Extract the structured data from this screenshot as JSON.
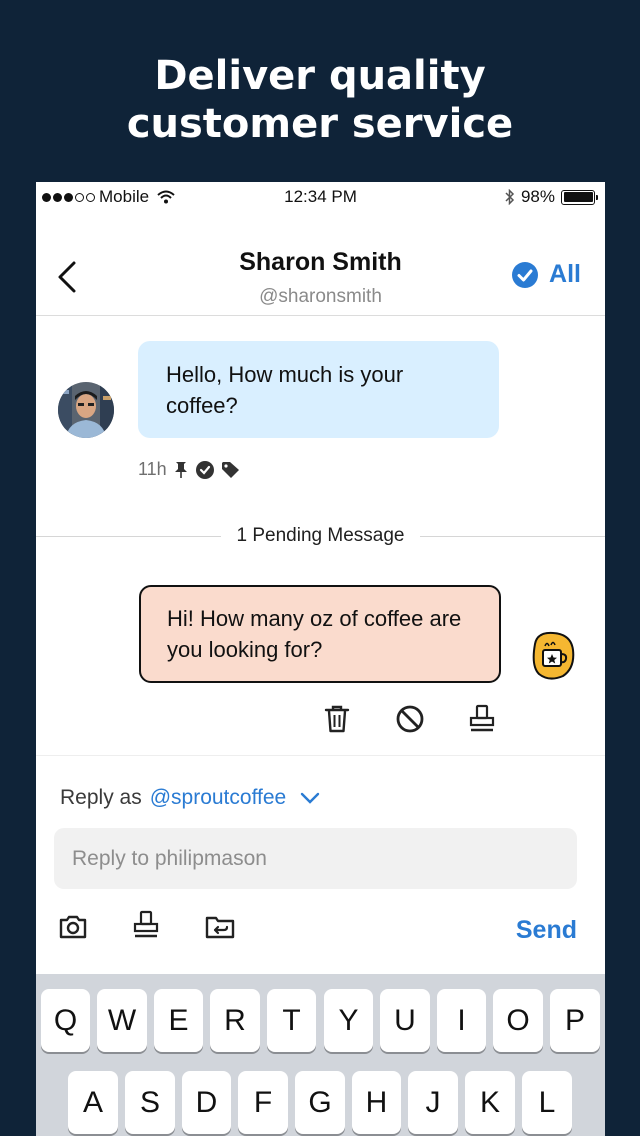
{
  "headline": {
    "line1": "Deliver quality",
    "line2": "customer service"
  },
  "status_bar": {
    "carrier": "Mobile",
    "time": "12:34 PM",
    "battery": "98%"
  },
  "header": {
    "contact_name": "Sharon Smith",
    "contact_handle": "@sharonsmith",
    "all_label": "All"
  },
  "conversation": {
    "incoming": {
      "text": "Hello, How much is your coffee?",
      "time": "11h"
    },
    "pending_label": "1 Pending Message",
    "outgoing": {
      "text": "Hi! How many oz of coffee are you looking for?"
    }
  },
  "composer": {
    "reply_as_label": "Reply as",
    "reply_as_handle": "@sproutcoffee",
    "input_placeholder": "Reply to philipmason",
    "send_label": "Send"
  },
  "keyboard": {
    "row1": [
      "Q",
      "W",
      "E",
      "R",
      "T",
      "Y",
      "U",
      "I",
      "O",
      "P"
    ],
    "row2": [
      "A",
      "S",
      "D",
      "F",
      "G",
      "H",
      "J",
      "K",
      "L"
    ]
  },
  "colors": {
    "page_bg": "#0f2338",
    "accent": "#2a7bd3",
    "incoming_bubble": "#d9efff",
    "outgoing_bubble": "#fadbcd"
  },
  "icons": [
    "chevron-left-icon",
    "check-circle-icon",
    "pin-icon",
    "tag-icon",
    "trash-icon",
    "block-icon",
    "stamp-icon",
    "camera-icon",
    "folder-share-icon",
    "wifi-icon",
    "bluetooth-icon"
  ]
}
